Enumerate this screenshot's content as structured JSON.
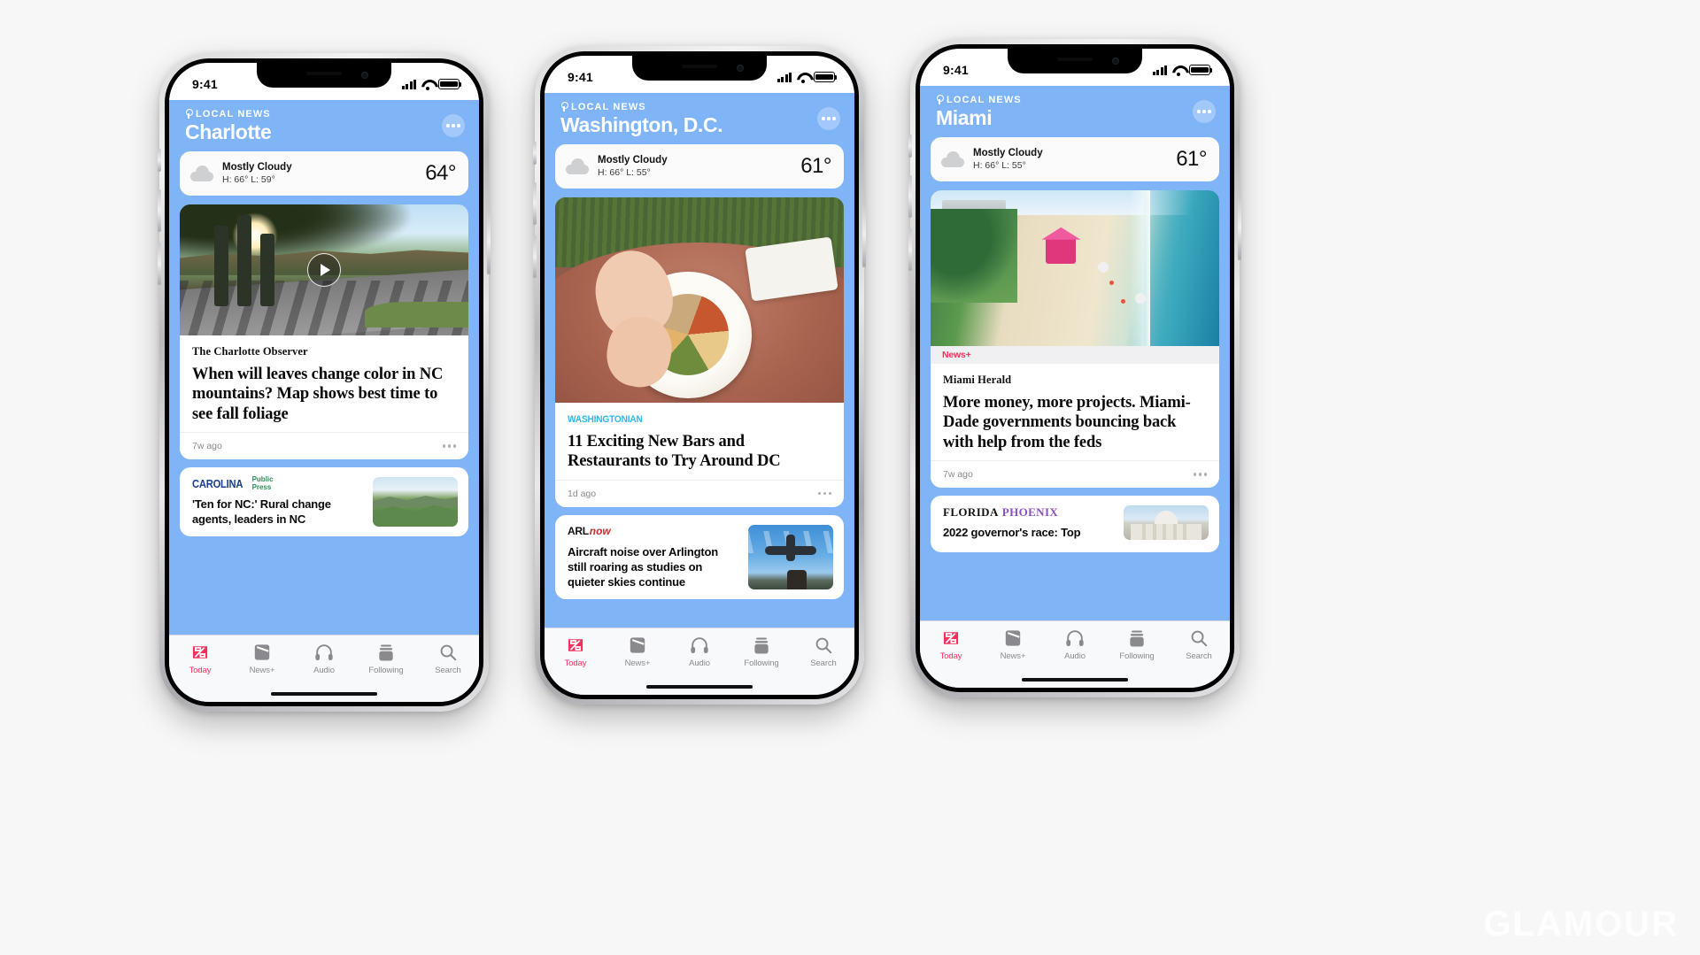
{
  "watermark": "GLAMOUR",
  "background_color": "#f7f7f7",
  "accent_colors": {
    "news_red": "#f4315c",
    "local_news_blue": "#7fb4f7",
    "washingtonian_cyan": "#2fb8e8",
    "carolina_blue": "#1c3f94",
    "florida_purple": "#8a4fc4"
  },
  "tabbar": {
    "tabs": [
      {
        "label": "Today",
        "icon": "apple-news-logo-icon",
        "active": true
      },
      {
        "label": "News+",
        "icon": "book-icon",
        "active": false
      },
      {
        "label": "Audio",
        "icon": "headphones-icon",
        "active": false
      },
      {
        "label": "Following",
        "icon": "heart-stack-icon",
        "active": false
      },
      {
        "label": "Search",
        "icon": "search-icon",
        "active": false
      }
    ]
  },
  "phones": [
    {
      "status": {
        "time": "9:41",
        "signal_icon": "cellular-bars-icon",
        "wifi_icon": "wifi-icon",
        "battery_icon": "battery-full-icon"
      },
      "header": {
        "kicker": "LOCAL NEWS",
        "city": "Charlotte",
        "pin_icon": "map-pin-icon",
        "more_icon": "more-options-icon"
      },
      "weather": {
        "icon": "cloud-icon",
        "condition": "Mostly Cloudy",
        "high_low": "H: 66°  L: 59°",
        "temperature": "64°"
      },
      "cards": [
        {
          "type": "hero",
          "has_video": true,
          "play_icon": "play-button-icon",
          "scene": "scene-road",
          "masthead": {
            "style": "serif",
            "text": "The Charlotte Observer"
          },
          "headline": "When will leaves change color in NC mountains? Map shows best time to see fall foliage",
          "timestamp": "7w ago",
          "more_icon": "more-options-icon"
        },
        {
          "type": "compact",
          "masthead": {
            "style": "carolina",
            "text": "CAROLINA",
            "sub1": "Public",
            "sub2": "Press"
          },
          "headline": "'Ten for NC:' Rural change agents, leaders in NC",
          "scene": "scene-mtn"
        }
      ]
    },
    {
      "status": {
        "time": "9:41",
        "signal_icon": "cellular-bars-icon",
        "wifi_icon": "wifi-icon",
        "battery_icon": "battery-full-icon"
      },
      "header": {
        "kicker": "LOCAL NEWS",
        "city": "Washington, D.C.",
        "pin_icon": "map-pin-icon",
        "more_icon": "more-options-icon"
      },
      "weather": {
        "icon": "cloud-icon",
        "condition": "Mostly Cloudy",
        "high_low": "H: 66°  L: 55°",
        "temperature": "61°"
      },
      "cards": [
        {
          "type": "hero",
          "has_video": false,
          "scene": "scene-food",
          "masthead": {
            "style": "washingtonian",
            "text": "WASHINGTONIAN"
          },
          "headline": "11 Exciting New Bars and Restaurants to Try Around DC",
          "timestamp": "1d ago",
          "more_icon": "more-options-icon"
        },
        {
          "type": "compact",
          "masthead": {
            "style": "arlnow",
            "text": "ARL",
            "sub1": "now"
          },
          "headline": "Aircraft noise over Arlington still roaring as studies on quieter skies continue",
          "scene": "scene-plane"
        }
      ]
    },
    {
      "status": {
        "time": "9:41",
        "signal_icon": "cellular-bars-icon",
        "wifi_icon": "wifi-icon",
        "battery_icon": "battery-full-icon"
      },
      "header": {
        "kicker": "LOCAL NEWS",
        "city": "Miami",
        "pin_icon": "map-pin-icon",
        "more_icon": "more-options-icon"
      },
      "weather": {
        "icon": "cloud-icon",
        "condition": "Mostly Cloudy",
        "high_low": "H: 66°  L: 55°",
        "temperature": "61°"
      },
      "cards": [
        {
          "type": "hero",
          "has_video": false,
          "scene": "scene-beach",
          "newsplus_badge": "News+",
          "apple_glyph": "",
          "masthead": {
            "style": "serif-miami",
            "text": "Miami Herald"
          },
          "headline": "More money, more projects. Miami-Dade governments bouncing back with help from the feds",
          "timestamp": "7w ago",
          "more_icon": "more-options-icon"
        },
        {
          "type": "compact",
          "masthead": {
            "style": "florida",
            "text": "FLORIDA",
            "sub1": "PHOENIX",
            "bird": ""
          },
          "headline": "2022 governor's race: Top",
          "scene": "scene-capitol"
        }
      ]
    }
  ]
}
